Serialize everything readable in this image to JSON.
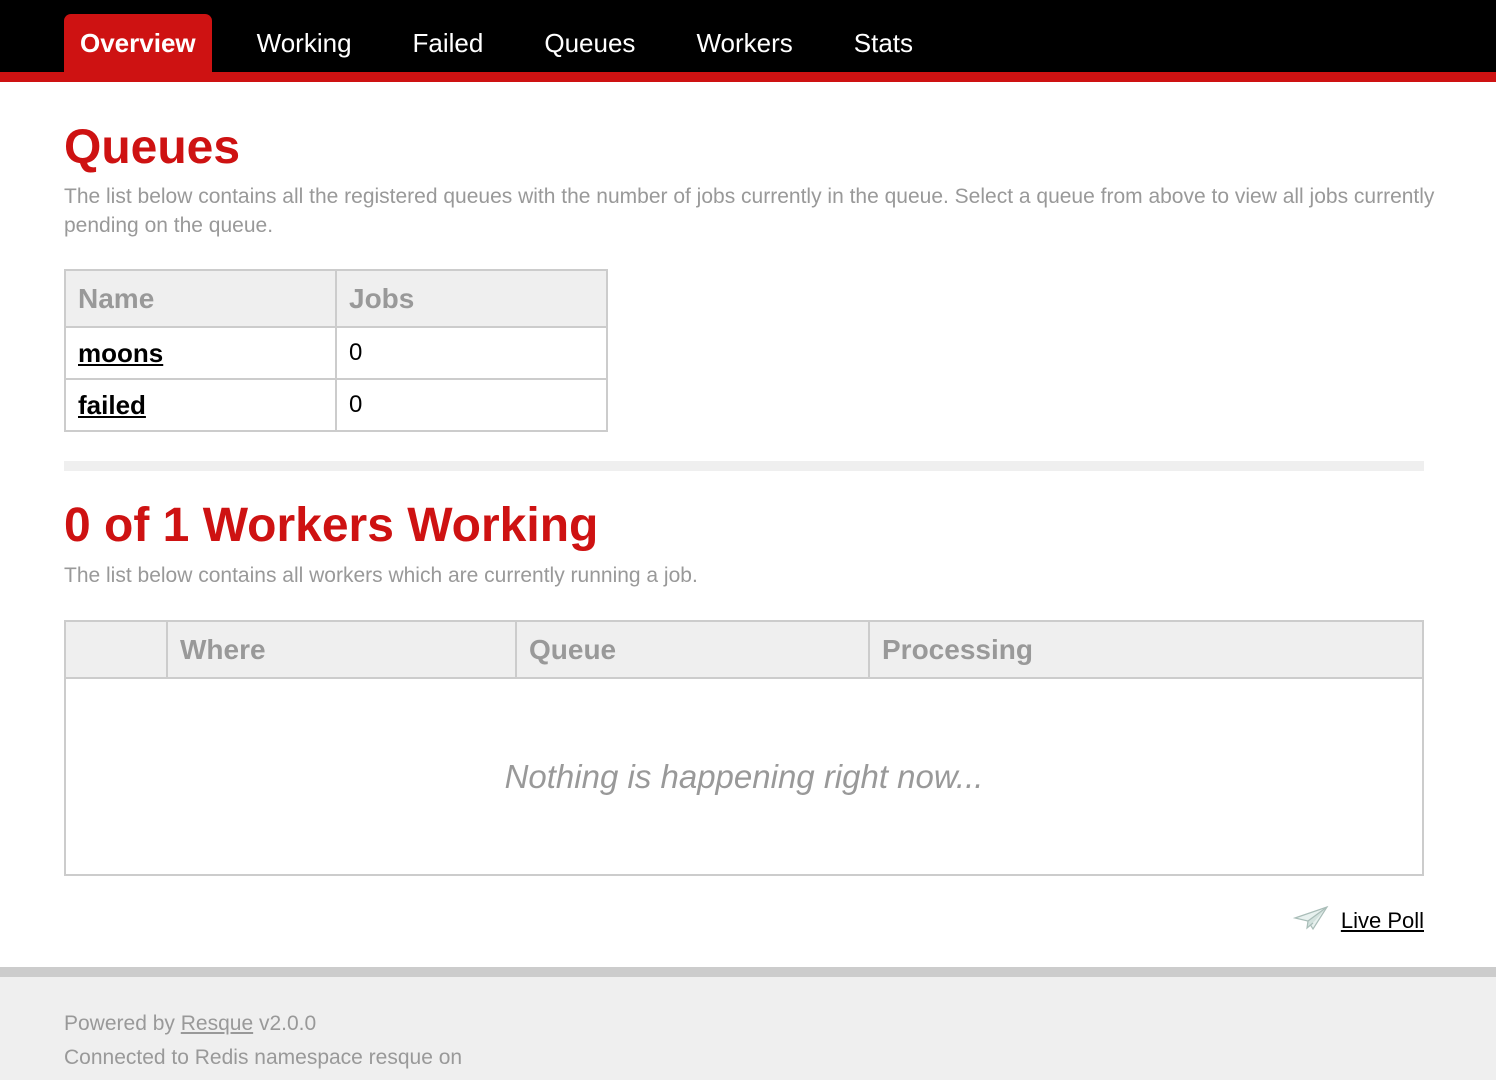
{
  "nav": {
    "tabs": [
      {
        "label": "Overview",
        "current": true
      },
      {
        "label": "Working",
        "current": false
      },
      {
        "label": "Failed",
        "current": false
      },
      {
        "label": "Queues",
        "current": false
      },
      {
        "label": "Workers",
        "current": false
      },
      {
        "label": "Stats",
        "current": false
      }
    ]
  },
  "queues_section": {
    "title": "Queues",
    "description": "The list below contains all the registered queues with the number of jobs currently in the queue. Select a queue from above to view all jobs currently pending on the queue.",
    "columns": [
      "Name",
      "Jobs"
    ],
    "rows": [
      {
        "name": "moons",
        "jobs": "0"
      },
      {
        "name": "failed",
        "jobs": "0"
      }
    ]
  },
  "workers_section": {
    "title": "0 of 1 Workers Working",
    "description": "The list below contains all workers which are currently running a job.",
    "columns": [
      "",
      "Where",
      "Queue",
      "Processing"
    ],
    "empty_message": "Nothing is happening right now..."
  },
  "live_poll": {
    "label": "Live Poll",
    "icon": "paper-plane-icon"
  },
  "footer": {
    "powered_prefix": "Powered by",
    "resque_link": "Resque",
    "version": "v2.0.0",
    "connection": "Connected to Redis namespace resque on"
  },
  "colors": {
    "accent": "#ce1212",
    "muted": "#999999",
    "header_bg": "#000000",
    "panel_bg": "#efefef",
    "border": "#cccccc"
  }
}
